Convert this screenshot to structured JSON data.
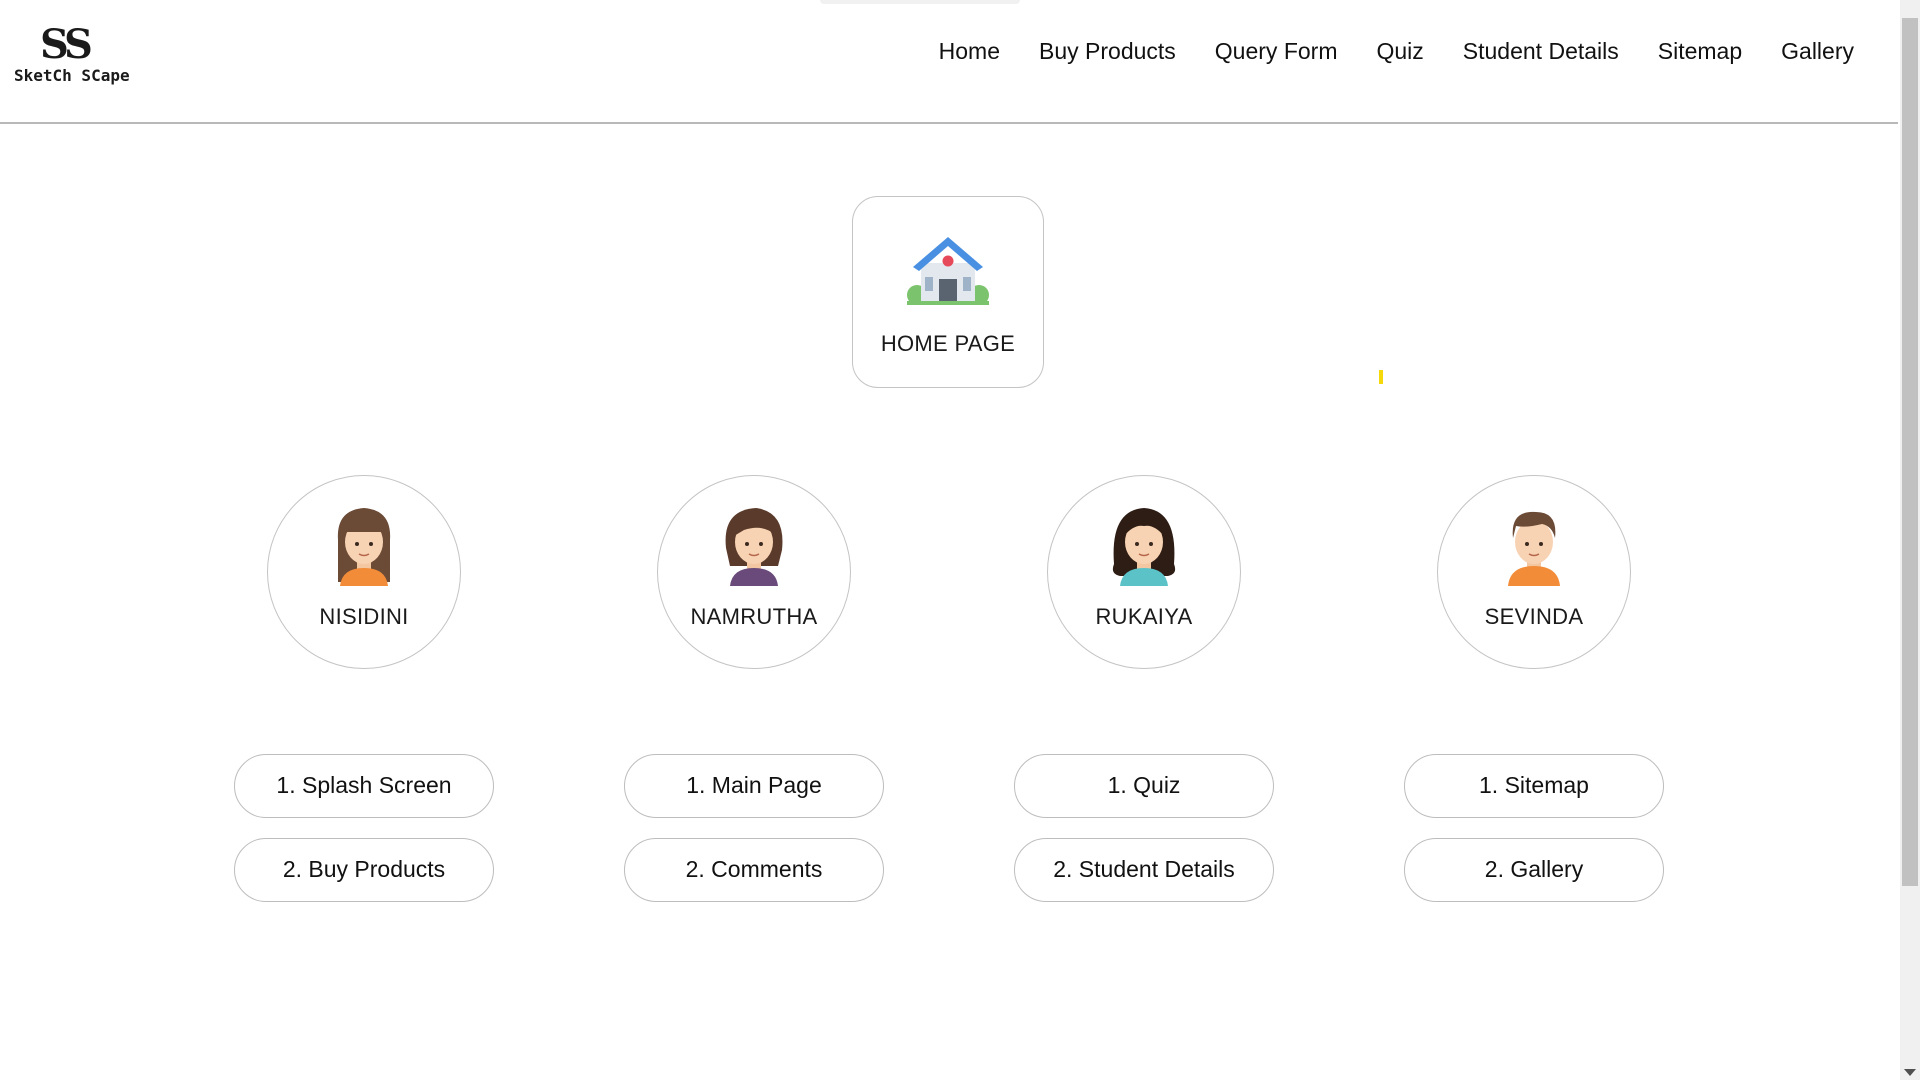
{
  "logo": {
    "mark": "SS",
    "text": "SketCh SCape"
  },
  "nav": {
    "items": [
      {
        "label": "Home"
      },
      {
        "label": "Buy Products"
      },
      {
        "label": "Query Form"
      },
      {
        "label": "Quiz"
      },
      {
        "label": "Student Details"
      },
      {
        "label": "Sitemap"
      },
      {
        "label": "Gallery"
      }
    ]
  },
  "home_card": {
    "label": "HOME PAGE",
    "icon": "house-icon"
  },
  "members": [
    {
      "name": "NISIDINI",
      "icon": "girl-avatar-icon",
      "pages": [
        "1. Splash Screen",
        "2. Buy Products"
      ]
    },
    {
      "name": "NAMRUTHA",
      "icon": "girl-avatar-icon",
      "pages": [
        "1. Main Page",
        "2. Comments"
      ]
    },
    {
      "name": "RUKAIYA",
      "icon": "girl-avatar-icon",
      "pages": [
        "1. Quiz",
        "2. Student Details"
      ]
    },
    {
      "name": "SEVINDA",
      "icon": "boy-avatar-icon",
      "pages": [
        "1. Sitemap",
        "2. Gallery"
      ]
    }
  ],
  "colors": {
    "border": "#c4c4c4",
    "header_border": "#b8b8b8",
    "house_roof": "#4a90e2",
    "accent_yellow": "#f5d90a"
  }
}
